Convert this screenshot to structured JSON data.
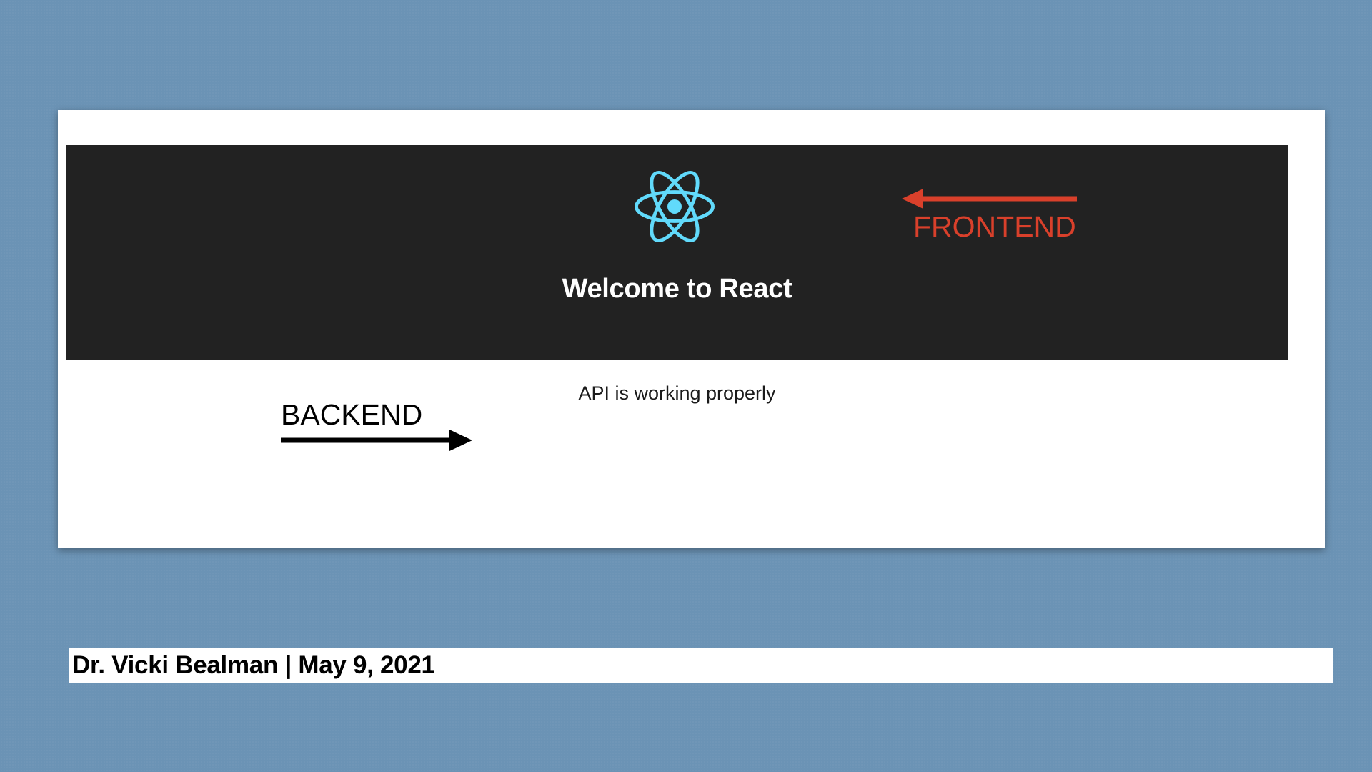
{
  "app": {
    "header_title": "Welcome to React",
    "logo_icon": "react-atom-icon",
    "api_message": "API is working properly"
  },
  "annotations": {
    "frontend": {
      "label": "FRONTEND",
      "arrow_direction": "left",
      "color": "#d9402b"
    },
    "backend": {
      "label": "BACKEND",
      "arrow_direction": "right",
      "color": "#000000"
    }
  },
  "footer": {
    "text": "Dr. Vicki Bealman | May 9, 2021"
  },
  "colors": {
    "slide_background": "#6b93b5",
    "header_background": "#222222",
    "react_logo": "#61dafb"
  }
}
